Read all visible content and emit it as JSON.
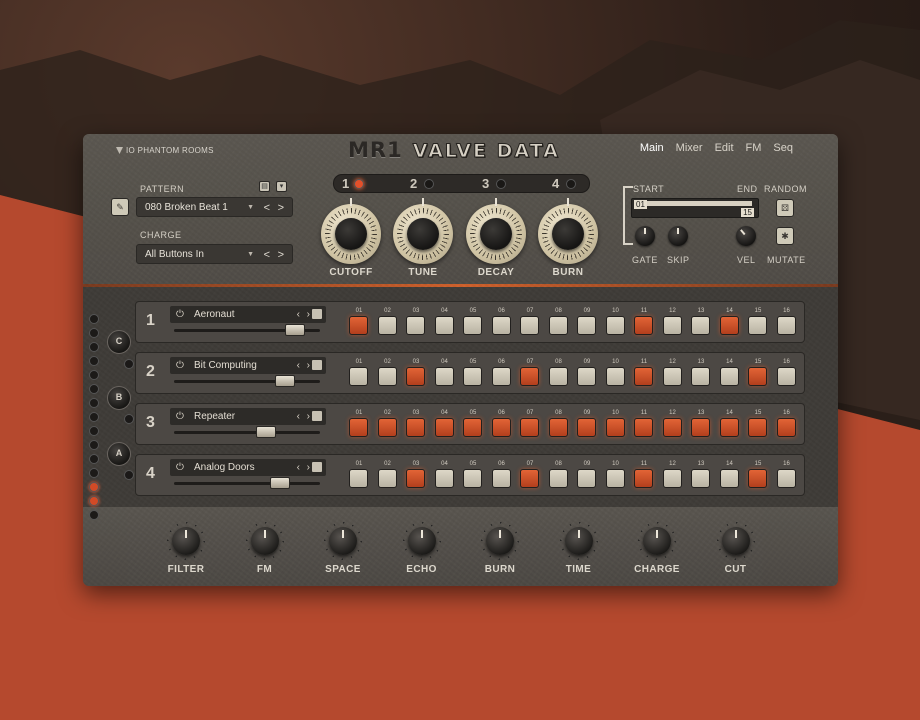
{
  "brand": "IO PHANTOM ROOMS",
  "title": {
    "main": "MR1",
    "sub": "VALVE DATA"
  },
  "nav": [
    "Main",
    "Mixer",
    "Edit",
    "FM",
    "Seq"
  ],
  "pattern": {
    "label": "PATTERN",
    "value": "080 Broken Beat 1",
    "prev": "<",
    "next": ">"
  },
  "charge": {
    "label": "CHARGE",
    "value": "All Buttons In",
    "prev": "<",
    "next": ">"
  },
  "banks": [
    {
      "label": "1",
      "active": true
    },
    {
      "label": "2",
      "active": false
    },
    {
      "label": "3",
      "active": false
    },
    {
      "label": "4",
      "active": false
    }
  ],
  "main_knobs": [
    "CUTOFF",
    "TUNE",
    "DECAY",
    "BURN"
  ],
  "range": {
    "start_label": "START",
    "end_label": "END",
    "start_value": "01",
    "end_value": "15"
  },
  "random_label": "RANDOM",
  "mutate_label": "MUTATE",
  "small_knobs": [
    "GATE",
    "SKIP",
    "VEL"
  ],
  "side_buttons": [
    "C",
    "B",
    "A"
  ],
  "step_numbers": [
    "01",
    "02",
    "03",
    "04",
    "05",
    "06",
    "07",
    "08",
    "09",
    "10",
    "11",
    "12",
    "13",
    "14",
    "15",
    "16"
  ],
  "tracks": [
    {
      "num": "1",
      "name": "Aeronaut",
      "level": 0.88,
      "steps": [
        1,
        0,
        0,
        0,
        0,
        0,
        0,
        0,
        0,
        0,
        1,
        0,
        0,
        1,
        0,
        0
      ]
    },
    {
      "num": "2",
      "name": "Bit Computing",
      "level": 0.8,
      "steps": [
        0,
        0,
        1,
        0,
        0,
        0,
        1,
        0,
        0,
        0,
        1,
        0,
        0,
        0,
        1,
        0
      ]
    },
    {
      "num": "3",
      "name": "Repeater",
      "level": 0.65,
      "steps": [
        1,
        1,
        1,
        1,
        1,
        1,
        1,
        1,
        1,
        1,
        1,
        1,
        1,
        1,
        1,
        1
      ]
    },
    {
      "num": "4",
      "name": "Analog Doors",
      "level": 0.76,
      "steps": [
        0,
        0,
        1,
        0,
        0,
        0,
        1,
        0,
        0,
        0,
        1,
        0,
        0,
        0,
        1,
        0
      ]
    }
  ],
  "fx_knobs": [
    "FILTER",
    "FM",
    "SPACE",
    "ECHO",
    "BURN",
    "TIME",
    "CHARGE",
    "CUT"
  ],
  "icons": {
    "pattern_icon": "pattern-edit-icon",
    "save": "save-icon",
    "menu": "menu-icon",
    "dice": "dice-icon",
    "power": "power-icon"
  },
  "colors": {
    "accent": "#d9552c",
    "panel": "#514d47",
    "step_off": "#cfc9b9"
  }
}
